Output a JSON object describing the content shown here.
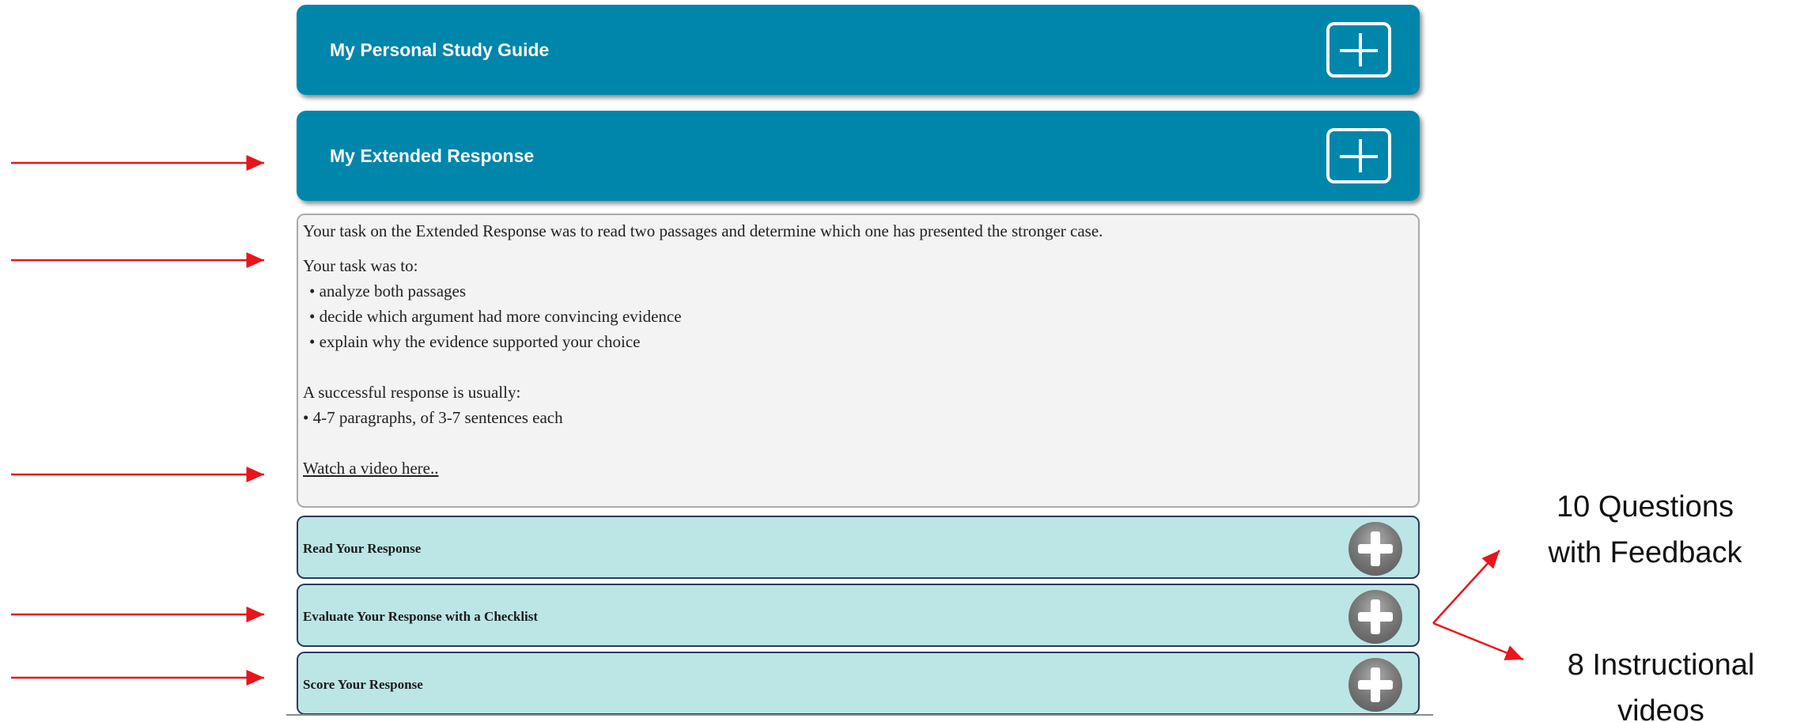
{
  "panels": [
    {
      "title": "My Personal Study Guide"
    },
    {
      "title": "My Extended Response"
    }
  ],
  "extended_response": {
    "intro": "Your task on the Extended Response was to read two passages and determine which one has presented the stronger case.",
    "task_heading": "Your task was to:",
    "task_items": [
      "• analyze both passages",
      "• decide which argument had more convincing evidence",
      "• explain why the evidence supported your choice"
    ],
    "success_heading": "A successful response is usually:",
    "success_item": "• 4-7 paragraphs, of 3-7 sentences each",
    "video_link": "Watch a video here.."
  },
  "accordions": [
    {
      "label": "Read Your Response"
    },
    {
      "label": "Evaluate Your Response with a Checklist"
    },
    {
      "label": "Score Your Response"
    }
  ],
  "annotations": {
    "questions_line1": "10 Questions",
    "questions_line2": "with Feedback",
    "videos_line1": "8  Instructional",
    "videos_line2": "videos"
  },
  "colors": {
    "panel_blue": "#0086ab",
    "accordion_teal": "#bce5e6",
    "annotation_red": "#e8151b"
  },
  "icons": [
    "plus-square-icon",
    "plus-circle-icon",
    "arrow-right-icon"
  ]
}
